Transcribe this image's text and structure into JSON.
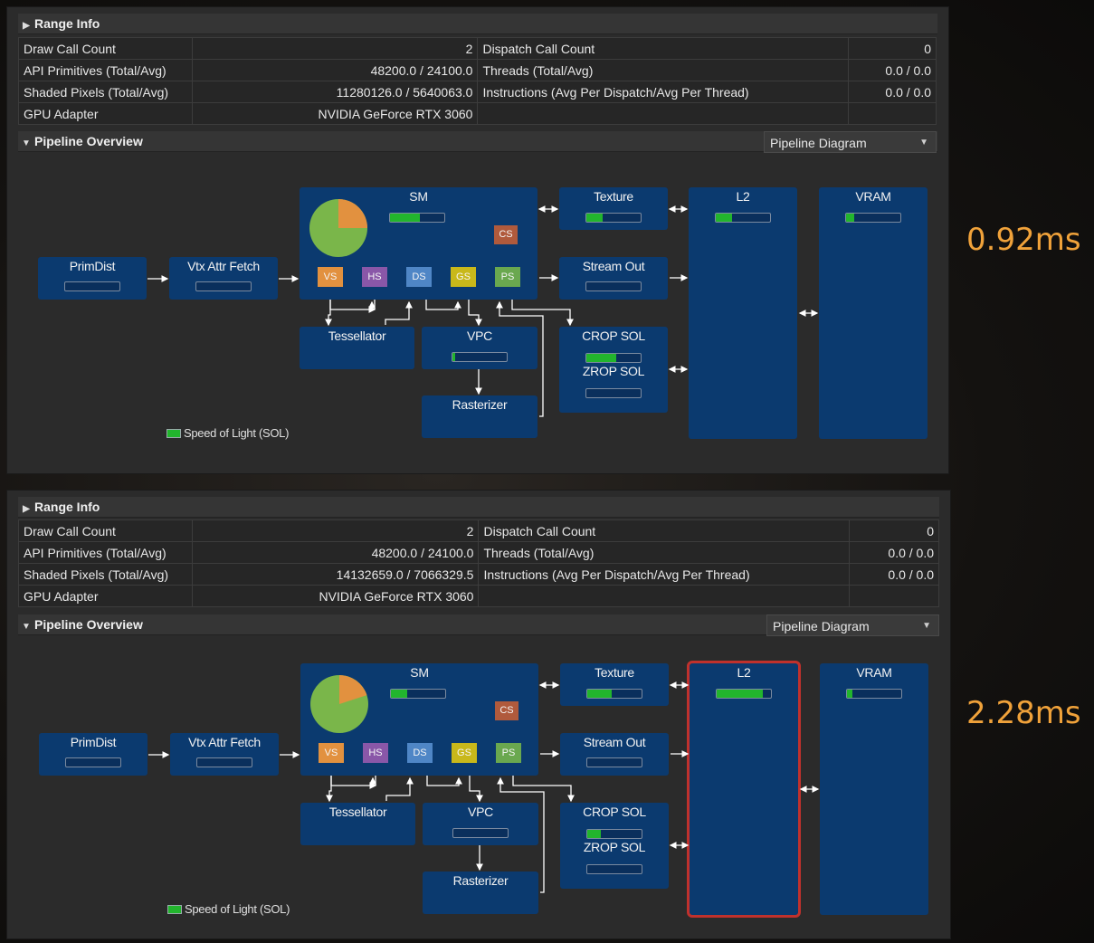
{
  "panels": [
    {
      "range_info": {
        "header": "Range Info",
        "rows": [
          [
            "Draw Call Count",
            "2",
            "Dispatch Call Count",
            "0"
          ],
          [
            "API Primitives (Total/Avg)",
            "48200.0 / 24100.0",
            "Threads (Total/Avg)",
            "0.0 / 0.0"
          ],
          [
            "Shaded Pixels (Total/Avg)",
            "11280126.0 / 5640063.0",
            "Instructions (Avg Per Dispatch/Avg Per Thread)",
            "0.0 / 0.0"
          ],
          [
            "GPU Adapter",
            "NVIDIA GeForce RTX 3060",
            "",
            ""
          ]
        ]
      },
      "pipeline": {
        "header": "Pipeline Overview",
        "view_select": "Pipeline Diagram",
        "units": {
          "primdist": {
            "label": "PrimDist",
            "sol": 0.0
          },
          "vtx_attr_fetch": {
            "label": "Vtx Attr Fetch",
            "sol": 0.0
          },
          "sm": {
            "label": "SM",
            "sol": 0.55,
            "pie_fraction": 0.25
          },
          "texture": {
            "label": "Texture",
            "sol": 0.3
          },
          "stream_out": {
            "label": "Stream Out",
            "sol": 0.0
          },
          "l2": {
            "label": "L2",
            "sol": 0.3
          },
          "vram": {
            "label": "VRAM",
            "sol": 0.15
          },
          "tessellator": {
            "label": "Tessellator"
          },
          "vpc": {
            "label": "VPC",
            "sol": 0.05
          },
          "rasterizer": {
            "label": "Rasterizer"
          },
          "crop": {
            "label": "CROP SOL",
            "sol": 0.55
          },
          "zrop": {
            "label": "ZROP SOL",
            "sol": 0.0
          }
        },
        "stages": [
          "VS",
          "HS",
          "DS",
          "GS",
          "PS"
        ],
        "cs_label": "CS",
        "legend": "Speed of Light (SOL)",
        "l2_highlighted": false
      },
      "timing": "0.92ms"
    },
    {
      "range_info": {
        "header": "Range Info",
        "rows": [
          [
            "Draw Call Count",
            "2",
            "Dispatch Call Count",
            "0"
          ],
          [
            "API Primitives (Total/Avg)",
            "48200.0 / 24100.0",
            "Threads (Total/Avg)",
            "0.0 / 0.0"
          ],
          [
            "Shaded Pixels (Total/Avg)",
            "14132659.0 / 7066329.5",
            "Instructions (Avg Per Dispatch/Avg Per Thread)",
            "0.0 / 0.0"
          ],
          [
            "GPU Adapter",
            "NVIDIA GeForce RTX 3060",
            "",
            ""
          ]
        ]
      },
      "pipeline": {
        "header": "Pipeline Overview",
        "view_select": "Pipeline Diagram",
        "units": {
          "primdist": {
            "label": "PrimDist",
            "sol": 0.0
          },
          "vtx_attr_fetch": {
            "label": "Vtx Attr Fetch",
            "sol": 0.0
          },
          "sm": {
            "label": "SM",
            "sol": 0.3,
            "pie_fraction": 0.2
          },
          "texture": {
            "label": "Texture",
            "sol": 0.45
          },
          "stream_out": {
            "label": "Stream Out",
            "sol": 0.0
          },
          "l2": {
            "label": "L2",
            "sol": 0.85
          },
          "vram": {
            "label": "VRAM",
            "sol": 0.1
          },
          "tessellator": {
            "label": "Tessellator"
          },
          "vpc": {
            "label": "VPC",
            "sol": 0.0
          },
          "rasterizer": {
            "label": "Rasterizer"
          },
          "crop": {
            "label": "CROP SOL",
            "sol": 0.25
          },
          "zrop": {
            "label": "ZROP SOL",
            "sol": 0.0
          }
        },
        "stages": [
          "VS",
          "HS",
          "DS",
          "GS",
          "PS"
        ],
        "cs_label": "CS",
        "legend": "Speed of Light (SOL)",
        "l2_highlighted": true
      },
      "timing": "2.28ms"
    }
  ],
  "colors": {
    "unit_bg": "#0b3a6f",
    "sol_fill": "#22b52d",
    "timing_text": "#f0a23a",
    "highlight": "#c0312c",
    "pie_main": "#7ab64a",
    "pie_slice": "#e2913f",
    "stage_vs": "#e2913f",
    "stage_hs": "#8a57a8",
    "stage_ds": "#4f86c6",
    "stage_gs": "#c9b81a",
    "stage_ps": "#6aa84f",
    "stage_cs": "#b05a3c"
  },
  "icons": {
    "collapsed": "triangle-right-icon",
    "expanded": "triangle-down-icon",
    "dropdown": "chevron-down-icon"
  }
}
